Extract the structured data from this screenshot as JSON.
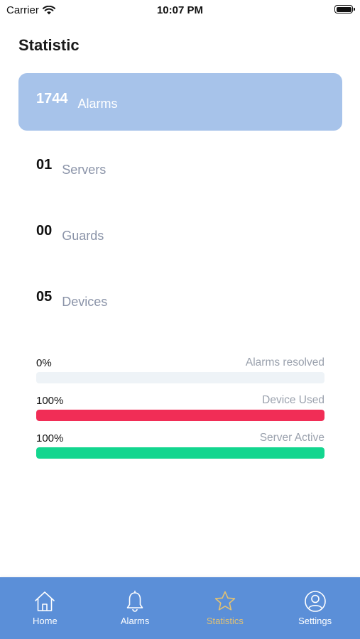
{
  "status_bar": {
    "carrier": "Carrier",
    "time": "10:07 PM",
    "icons": [
      "wifi-icon",
      "battery-icon"
    ]
  },
  "page": {
    "title": "Statistic"
  },
  "stats": [
    {
      "value": "1744",
      "label": "Alarms",
      "selected": true
    },
    {
      "value": "01",
      "label": "Servers",
      "selected": false
    },
    {
      "value": "00",
      "label": "Guards",
      "selected": false
    },
    {
      "value": "05",
      "label": "Devices",
      "selected": false
    }
  ],
  "progress": [
    {
      "percent_text": "0%",
      "label": "Alarms resolved",
      "fraction": 0.0,
      "color": "#f43c5e"
    },
    {
      "percent_text": "100%",
      "label": "Device Used",
      "fraction": 1.0,
      "color": "#f12d56"
    },
    {
      "percent_text": "100%",
      "label": "Server Active",
      "fraction": 1.0,
      "color": "#13d68f"
    }
  ],
  "colors": {
    "selected_card": "#a7c3ea",
    "tab_bar": "#5b8fd8",
    "tab_active": "#e2c173",
    "track": "#eef3f7"
  },
  "tabs": [
    {
      "label": "Home",
      "icon": "home-icon",
      "active": false
    },
    {
      "label": "Alarms",
      "icon": "bell-icon",
      "active": false
    },
    {
      "label": "Statistics",
      "icon": "star-icon",
      "active": true
    },
    {
      "label": "Settings",
      "icon": "profile-icon",
      "active": false
    }
  ]
}
